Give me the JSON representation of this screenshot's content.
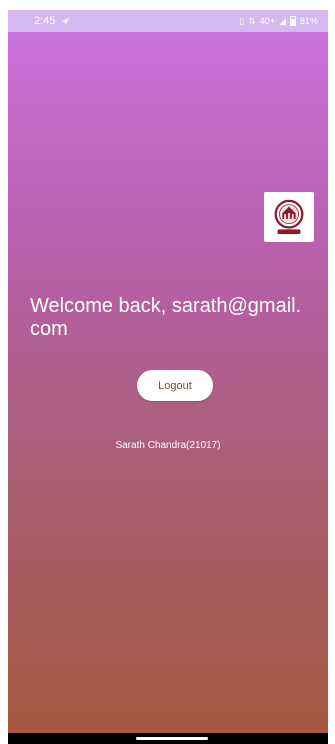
{
  "status_bar": {
    "time": "2:45",
    "indicators": "40+",
    "battery": "81%",
    "icons": [
      "navigation-arrow-icon",
      "vibrate-icon",
      "data-icon",
      "signal-icon",
      "battery-icon"
    ]
  },
  "logo": {
    "icon": "university-emblem-icon",
    "caption": "सदृशाय नमः ज्ञानं"
  },
  "welcome": {
    "text": "Welcome back, sarath@gmail.com"
  },
  "actions": {
    "logout_label": "Logout"
  },
  "footer": {
    "name": "Sarath Chandra(21017)"
  },
  "colors": {
    "gradient_top": "#cd72e0",
    "gradient_bottom": "#a75740",
    "status_bar": "#d4b8f0",
    "button_text": "#7a4a43"
  }
}
